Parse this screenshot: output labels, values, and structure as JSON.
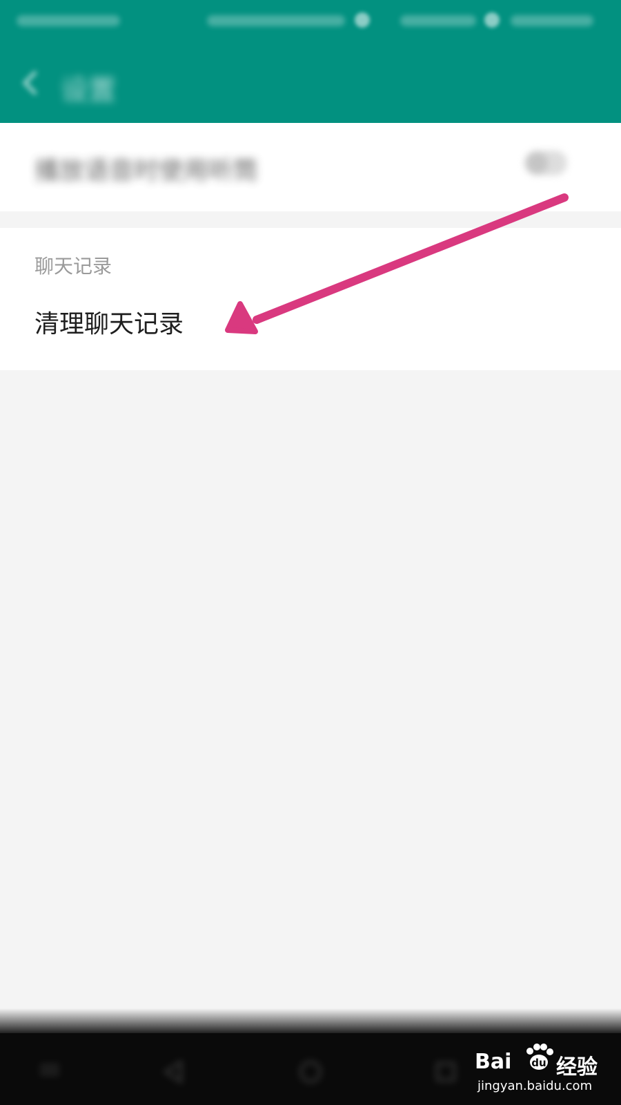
{
  "header": {
    "title": "设置",
    "background_color": "#029180",
    "back_icon": "chevron-left-icon"
  },
  "settings": {
    "voice_row_label": "播放语音时使用听筒",
    "toggle_state": "off"
  },
  "chat_section": {
    "header": "聊天记录",
    "clear_item_label": "清理聊天记录"
  },
  "annotation": {
    "arrow_color": "#d9397f",
    "arrow_icon": "arrow-pointer"
  },
  "watermark": {
    "brand_latin": "Bai",
    "brand_du": "du",
    "brand_cn": "经验",
    "url": "jingyan.baidu.com"
  },
  "nav_bar": {
    "icons": [
      "menu-icon",
      "back-icon",
      "home-icon",
      "recent-apps-icon"
    ]
  }
}
